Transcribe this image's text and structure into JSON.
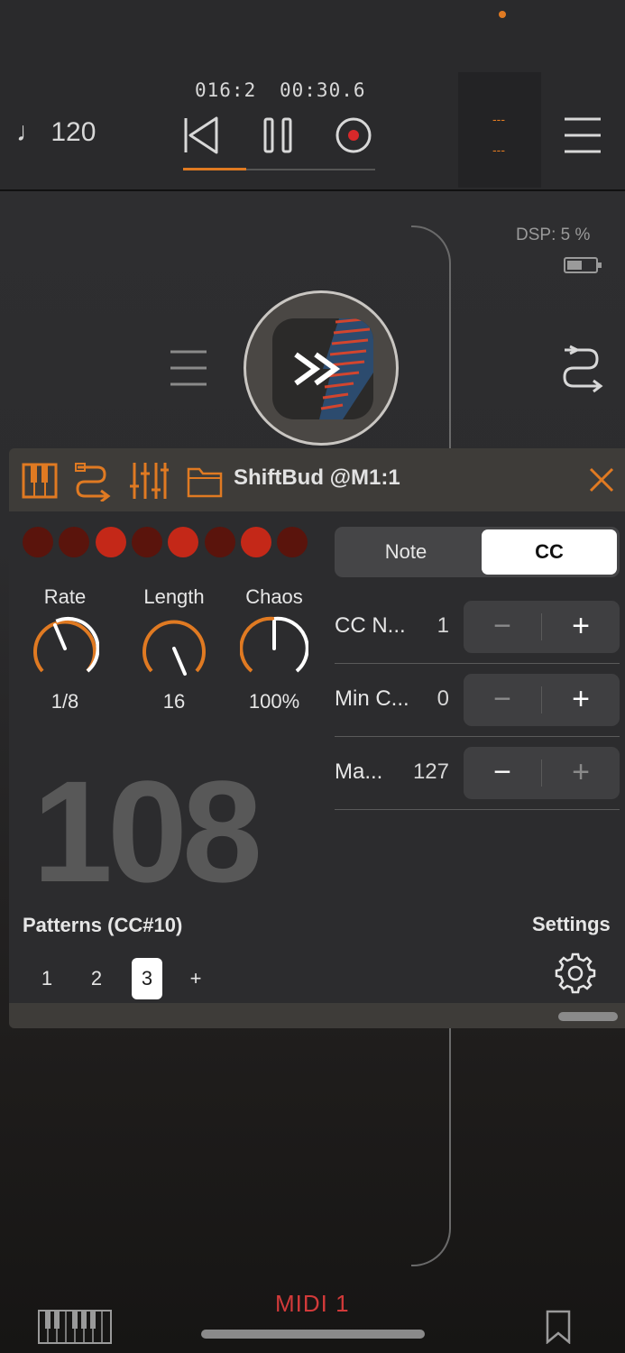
{
  "transport": {
    "tempo": "♩ 120",
    "position": "016:2",
    "time": "00:30.6",
    "progress": 0.33,
    "lane_indicator": "---"
  },
  "status": {
    "dsp": "DSP:  5 %"
  },
  "plugin": {
    "title": "ShiftBud @M1:1",
    "leds": [
      false,
      false,
      true,
      false,
      true,
      false,
      true,
      false
    ],
    "knobs": [
      {
        "label": "Rate",
        "value": "1/8"
      },
      {
        "label": "Length",
        "value": "16"
      },
      {
        "label": "Chaos",
        "value": "100%"
      }
    ],
    "big_number": "108",
    "patterns_title": "Patterns (CC#10)",
    "patterns": [
      "1",
      "2",
      "3",
      "+"
    ],
    "active_pattern": "3",
    "settings_label": "Settings",
    "segment": {
      "note": "Note",
      "cc": "CC",
      "selected": "CC"
    },
    "rows": [
      {
        "label": "CC N...",
        "value": "1"
      },
      {
        "label": "Min C...",
        "value": "0"
      },
      {
        "label": "Ma...",
        "value": "127"
      }
    ],
    "stepper": {
      "minus": "−",
      "plus": "+"
    }
  },
  "bottom": {
    "midi_label": "MIDI 1"
  },
  "colors": {
    "accent": "#e07a22",
    "led_on": "#c42818",
    "led_off": "#5a140c",
    "midi": "#d23a3a"
  }
}
